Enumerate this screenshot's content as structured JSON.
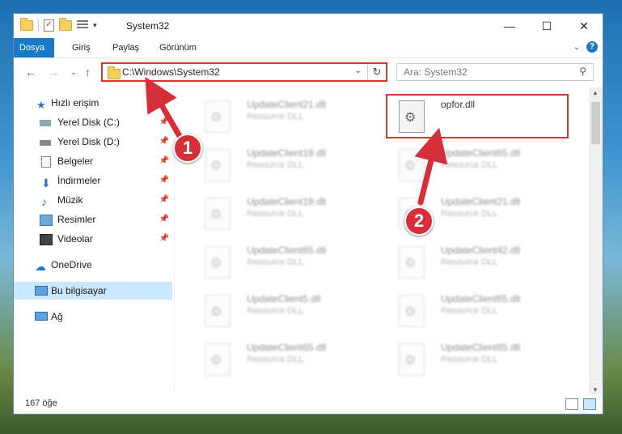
{
  "window": {
    "title": "System32",
    "controls": {
      "minimize": "—",
      "maximize": "☐",
      "close": "✕"
    }
  },
  "ribbon": {
    "tabs": [
      "Dosya",
      "Giriş",
      "Paylaş",
      "Görünüm"
    ]
  },
  "address": {
    "path": "C:\\Windows\\System32",
    "search_placeholder": "Ara: System32"
  },
  "sidebar": {
    "items": [
      {
        "label": "Hızlı erişim",
        "icon": "star-icon"
      },
      {
        "label": "Yerel Disk (C:)",
        "icon": "drive-icon"
      },
      {
        "label": "Yerel Disk (D:)",
        "icon": "drive-icon"
      },
      {
        "label": "Belgeler",
        "icon": "documents-icon"
      },
      {
        "label": "İndirmeler",
        "icon": "download-icon"
      },
      {
        "label": "Müzik",
        "icon": "music-icon"
      },
      {
        "label": "Resimler",
        "icon": "pictures-icon"
      },
      {
        "label": "Videolar",
        "icon": "videos-icon"
      },
      {
        "label": "OneDrive",
        "icon": "cloud-icon"
      },
      {
        "label": "Bu bilgisayar",
        "icon": "computer-icon"
      },
      {
        "label": "Ağ",
        "icon": "network-icon"
      }
    ]
  },
  "files": [
    {
      "name": "UpdateClient21.dll",
      "type": "Resource DLL"
    },
    {
      "name": "opfor.dll",
      "type": ""
    },
    {
      "name": "UpdateClient19.dll",
      "type": "Resource DLL"
    },
    {
      "name": "UpdateClient65.dll",
      "type": "Resource DLL"
    },
    {
      "name": "UpdateClient19.dll",
      "type": "Resource DLL"
    },
    {
      "name": "UpdateClient21.dll",
      "type": "Resource DLL"
    },
    {
      "name": "UpdateClient65.dll",
      "type": "Resource DLL"
    },
    {
      "name": "UpdateClient42.dll",
      "type": "Resource DLL"
    },
    {
      "name": "UpdateClient5.dll",
      "type": "Resource DLL"
    },
    {
      "name": "UpdateClient65.dll",
      "type": "Resource DLL"
    },
    {
      "name": "UpdateClient65.dll",
      "type": "Resource DLL"
    },
    {
      "name": "UpdateClient65.dll",
      "type": "Resource DLL"
    }
  ],
  "status": {
    "count": "167 öğe"
  },
  "annotations": {
    "step1": "1",
    "step2": "2"
  },
  "colors": {
    "accent": "#1979ca",
    "highlight": "#e03030",
    "badge": "#d62f3a"
  }
}
